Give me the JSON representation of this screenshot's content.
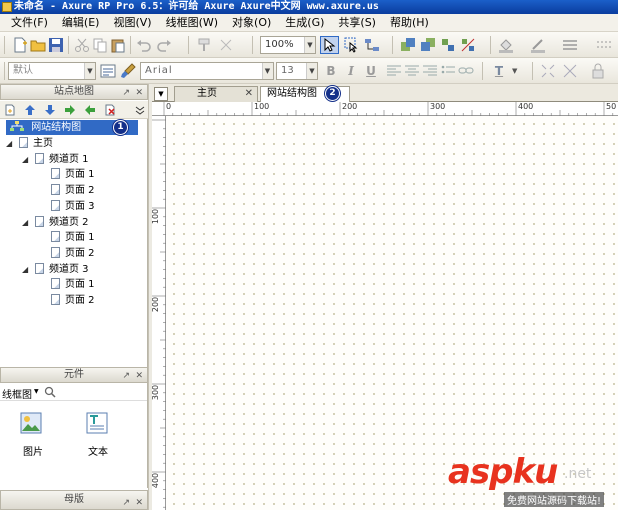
{
  "window": {
    "title": "未命名 - Axure RP Pro 6.5：许可给 Axure Axure中文网 www.axure.us"
  },
  "menu": [
    "文件(F)",
    "编辑(E)",
    "视图(V)",
    "线框图(W)",
    "对象(O)",
    "生成(G)",
    "共享(S)",
    "帮助(H)"
  ],
  "toolbar": {
    "zoom": "100%",
    "style_select": "默认",
    "font_family": "Arial",
    "font_size": "13",
    "bold": "B",
    "italic": "I",
    "underline": "U",
    "text_color": "T"
  },
  "sitemap_panel": {
    "title": "站点地图",
    "pin": "↗",
    "close": "✕",
    "root_label": "网站结构图",
    "root_badge": "1",
    "tree": [
      {
        "label": "主页",
        "level": 0,
        "expanded": true
      },
      {
        "label": "频道页 1",
        "level": 1,
        "expanded": true
      },
      {
        "label": "页面 1",
        "level": 2
      },
      {
        "label": "页面 2",
        "level": 2
      },
      {
        "label": "页面 3",
        "level": 2
      },
      {
        "label": "频道页 2",
        "level": 1,
        "expanded": true
      },
      {
        "label": "页面 1",
        "level": 2
      },
      {
        "label": "页面 2",
        "level": 2
      },
      {
        "label": "频道页 3",
        "level": 1,
        "expanded": true
      },
      {
        "label": "页面 1",
        "level": 2
      },
      {
        "label": "页面 2",
        "level": 2
      }
    ]
  },
  "widgets_panel": {
    "title": "元件",
    "library": "线框图",
    "items": [
      {
        "label": "图片"
      },
      {
        "label": "文本"
      }
    ]
  },
  "masters_panel": {
    "title": "母版"
  },
  "tabs": [
    {
      "label": "主页",
      "active": false,
      "close": "✕"
    },
    {
      "label": "网站结构图",
      "active": true,
      "badge": "2"
    }
  ],
  "tab_menu_arrow": "▼",
  "ruler": {
    "top_labels": [
      "0",
      "100",
      "200",
      "300",
      "400",
      "50"
    ],
    "left_labels": [
      "100",
      "200",
      "300",
      "400"
    ]
  },
  "watermark": {
    "main": "aspku",
    "suffix": ".net",
    "sub": "免费网站源码下载站!"
  },
  "colors": {
    "selection": "#316ac5",
    "badge": "#14308a",
    "watermark_red": "#e8321e"
  }
}
